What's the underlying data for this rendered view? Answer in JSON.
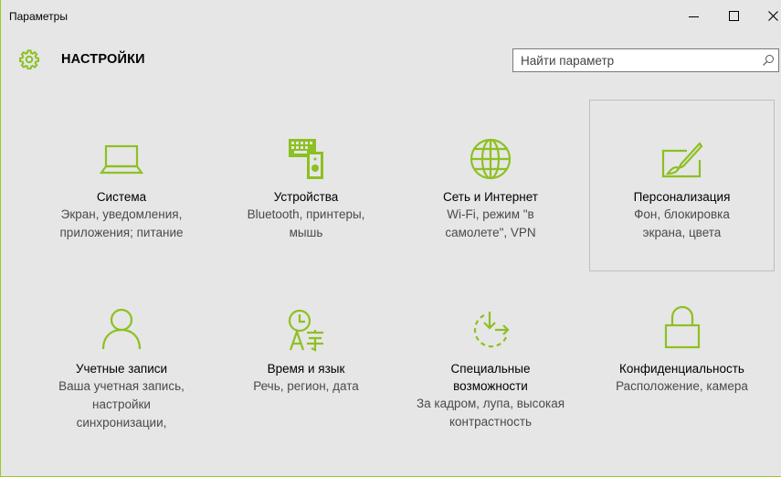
{
  "window": {
    "title": "Параметры",
    "accent_color": "#8dc021"
  },
  "header": {
    "title": "НАСТРОЙКИ",
    "icon": "gear-icon"
  },
  "search": {
    "placeholder": "Найти параметр",
    "value": ""
  },
  "tiles": [
    {
      "name": "Система",
      "desc": "Экран, уведомления, приложения; питание",
      "icon": "laptop-icon"
    },
    {
      "name": "Устройства",
      "desc": "Bluetooth, принтеры, мышь",
      "icon": "devices-icon"
    },
    {
      "name": "Сеть и Интернет",
      "desc": "Wi-Fi, режим \"в самолете\", VPN",
      "icon": "globe-icon"
    },
    {
      "name": "Персонализация",
      "desc": "Фон, блокировка экрана, цвета",
      "icon": "personalization-icon"
    },
    {
      "name": "Учетные записи",
      "desc": "Ваша учетная запись, настройки синхронизации,",
      "icon": "person-icon"
    },
    {
      "name": "Время и язык",
      "desc": "Речь, регион, дата",
      "icon": "time-language-icon"
    },
    {
      "name": "Специальные возможности",
      "desc": "За кадром, лупа, высокая контрастность",
      "icon": "ease-of-access-icon"
    },
    {
      "name": "Конфиденциальность",
      "desc": "Расположение, камера",
      "icon": "lock-icon"
    }
  ]
}
